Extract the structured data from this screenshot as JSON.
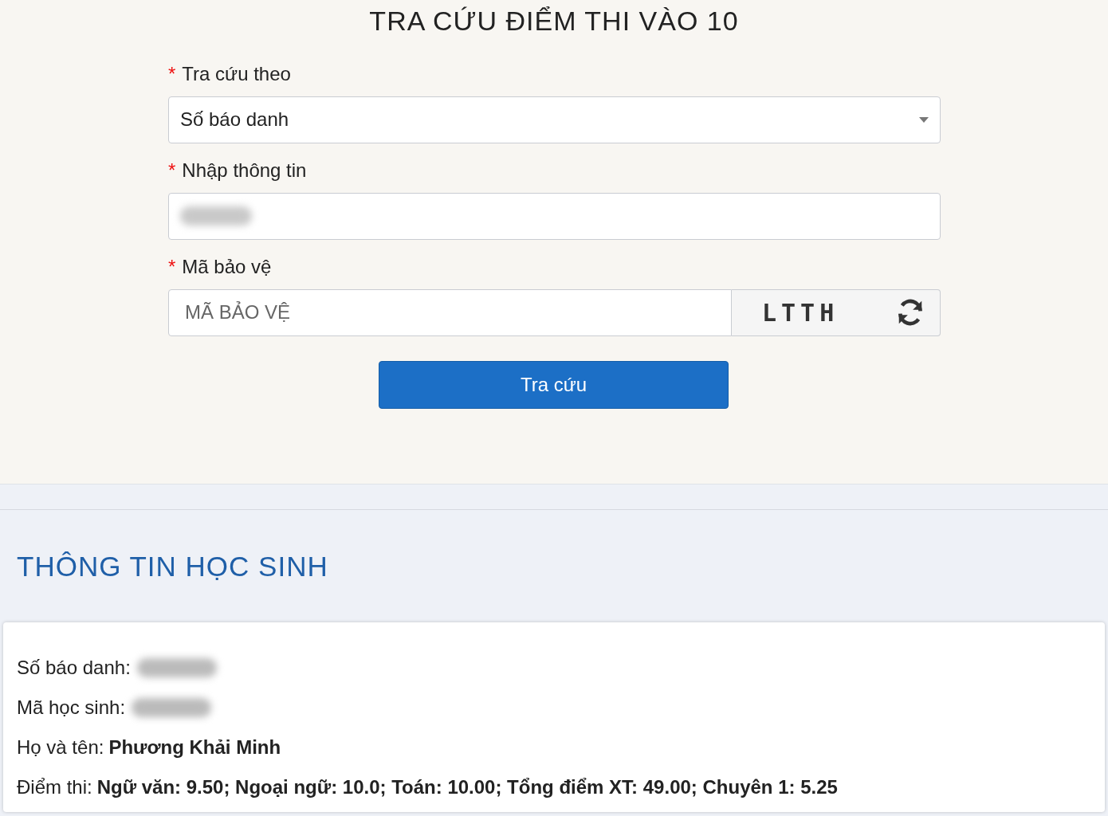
{
  "title": "TRA CỨU ĐIỂM THI VÀO 10",
  "form": {
    "fields": [
      {
        "kind": "select",
        "required": true,
        "required_mark": "*",
        "label": "Tra cứu theo",
        "value": "Số báo danh"
      },
      {
        "kind": "input",
        "required": true,
        "required_mark": "*",
        "label": "Nhập thông tin",
        "value_blurred": true
      },
      {
        "kind": "captcha",
        "required": true,
        "required_mark": "*",
        "label": "Mã bảo vệ",
        "placeholder": "MÃ BẢO VỆ",
        "captcha_text": "LTTH"
      }
    ],
    "submit": "Tra cứu"
  },
  "student": {
    "heading": "THÔNG TIN HỌC SINH",
    "rows": [
      {
        "kind": "blurred",
        "label": "Số báo danh:"
      },
      {
        "kind": "blurred",
        "label": "Mã học sinh:"
      },
      {
        "kind": "text",
        "label": "Họ và tên:",
        "value": "Phương Khải Minh"
      },
      {
        "kind": "text",
        "label": "Điểm thi:",
        "value": "Ngữ văn: 9.50; Ngoại ngữ: 10.0; Toán: 10.00; Tổng điểm XT: 49.00; Chuyên 1: 5.25"
      }
    ]
  }
}
